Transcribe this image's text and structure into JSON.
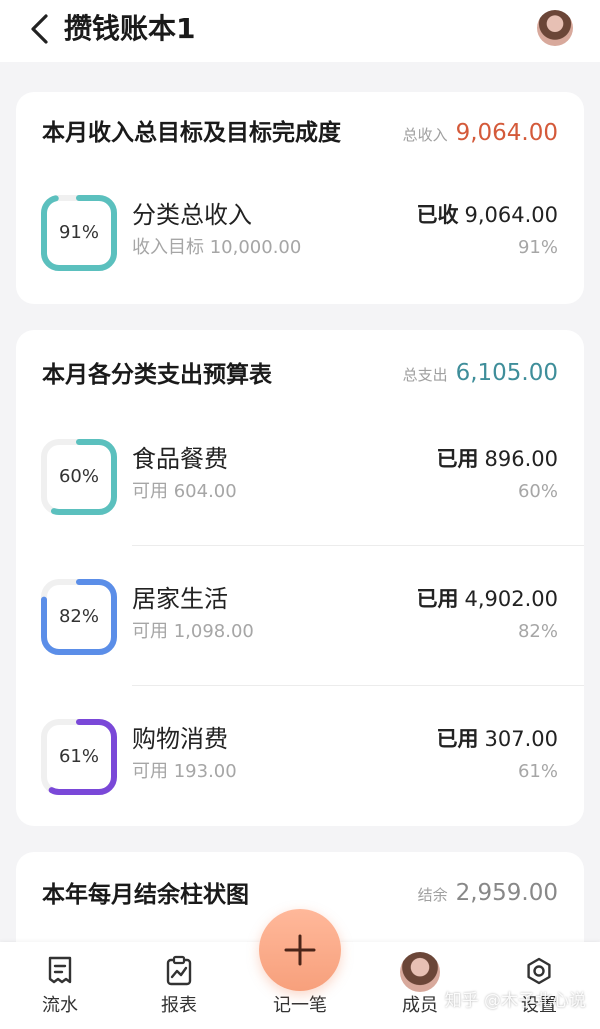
{
  "header": {
    "title": "攒钱账本1"
  },
  "income": {
    "title": "本月收入总目标及目标完成度",
    "total_label": "总收入",
    "total_value": "9,064.00",
    "total_color": "#d45a3a",
    "item": {
      "name": "分类总收入",
      "sub": "收入目标 10,000.00",
      "right_key": "已收",
      "right_value": "9,064.00",
      "pct": "91%",
      "progress": 0.91,
      "ring_color": "#5bc0be"
    }
  },
  "budget": {
    "title": "本月各分类支出预算表",
    "total_label": "总支出",
    "total_value": "6,105.00",
    "total_color": "#3f8e9a",
    "items": [
      {
        "name": "食品餐费",
        "sub": "可用 604.00",
        "right_key": "已用",
        "right_value": "896.00",
        "pct": "60%",
        "progress": 0.6,
        "ring_color": "#5bc0be"
      },
      {
        "name": "居家生活",
        "sub": "可用 1,098.00",
        "right_key": "已用",
        "right_value": "4,902.00",
        "pct": "82%",
        "progress": 0.82,
        "ring_color": "#5b8ee8"
      },
      {
        "name": "购物消费",
        "sub": "可用 193.00",
        "right_key": "已用",
        "right_value": "307.00",
        "pct": "61%",
        "progress": 0.61,
        "ring_color": "#7a48d8"
      }
    ]
  },
  "balance": {
    "title": "本年每月结余柱状图",
    "total_label": "结余",
    "total_value": "2,959.00"
  },
  "nav": {
    "items": [
      "流水",
      "报表",
      "记一笔",
      "成员",
      "设置"
    ]
  },
  "watermark": "知乎 @木子北心说",
  "colors": {
    "ring_track": "#f0f0f0",
    "fab": "#f7a07c"
  }
}
